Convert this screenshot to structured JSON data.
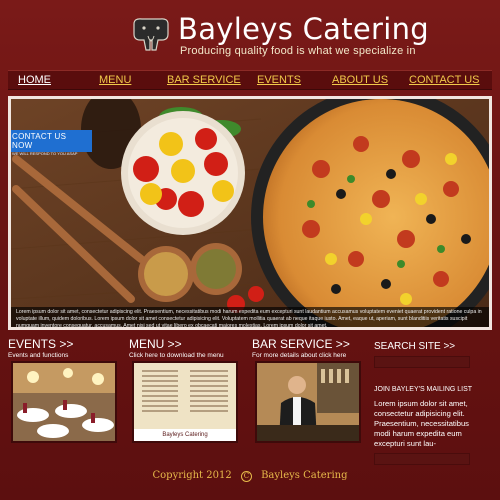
{
  "header": {
    "title": "Bayleys Catering",
    "tagline": "Producing quality food  is what we specialize in",
    "logo_icon": "elephant-icon"
  },
  "nav": {
    "items": [
      {
        "label": "HOME",
        "active": true
      },
      {
        "label": "MENU"
      },
      {
        "label": "BAR SERVICE"
      },
      {
        "label": "EVENTS"
      },
      {
        "label": "ABOUT US"
      },
      {
        "label": "CONTACT US"
      }
    ]
  },
  "hero": {
    "contact_tab": "CONTACT US NOW",
    "contact_sub": "WE WILL RESPOND TO YOU ASAP",
    "caption": "Lorem ipsum dolor sit amet, consectetur adipiscing elit. Praesentium, necessitatibus modi harum expedita eum excepturi sunt laudantium accusamus voluptatem eveniet quaerat provident ratione culpa in voluptate illum, quidem doloribus. Lorem ipsum dolor sit amet consectetur adipisicing elit. Voluptatem mollitia quaerat ab neque itaque iusto. Amet, eaque ut, aperiam, sunt blanditiis veritatis suscipit numquam inventore consequatur, accusamus. Amet nisi sed ut vitae libero ex obcaecati maiores molestias. Lorem ipsum dolor sit amet.",
    "image_icon": "pizza-photo"
  },
  "panels": [
    {
      "title": "EVENTS >>",
      "sub": "Events and functions",
      "image_icon": "banquet-hall-photo"
    },
    {
      "title": "MENU >>",
      "sub": "Click here to download the menu",
      "image_icon": "menu-card-photo",
      "menu_brand": "Bayleys Catering"
    },
    {
      "title": "BAR SERVICE >>",
      "sub": "For more details about click here",
      "image_icon": "bartender-photo"
    }
  ],
  "sidebar": {
    "search_title": "SEARCH SITE >>",
    "mailing_title": "JOIN BAYLEY'S MAILING LIST",
    "mailing_text": "Lorem ipsum dolor sit amet, consectetur adipisicing elit. Praesentium, necessitatibus modi harum expedita eum excepturi sunt lau-"
  },
  "footer": {
    "copyright_year": "Copyright 2012",
    "symbol": "C",
    "company": "Bayleys Catering"
  },
  "colors": {
    "background": "#6b1413",
    "nav_link": "#f1c94a",
    "accent_blue": "#1f6fd1",
    "footer_text": "#e6b94a"
  }
}
